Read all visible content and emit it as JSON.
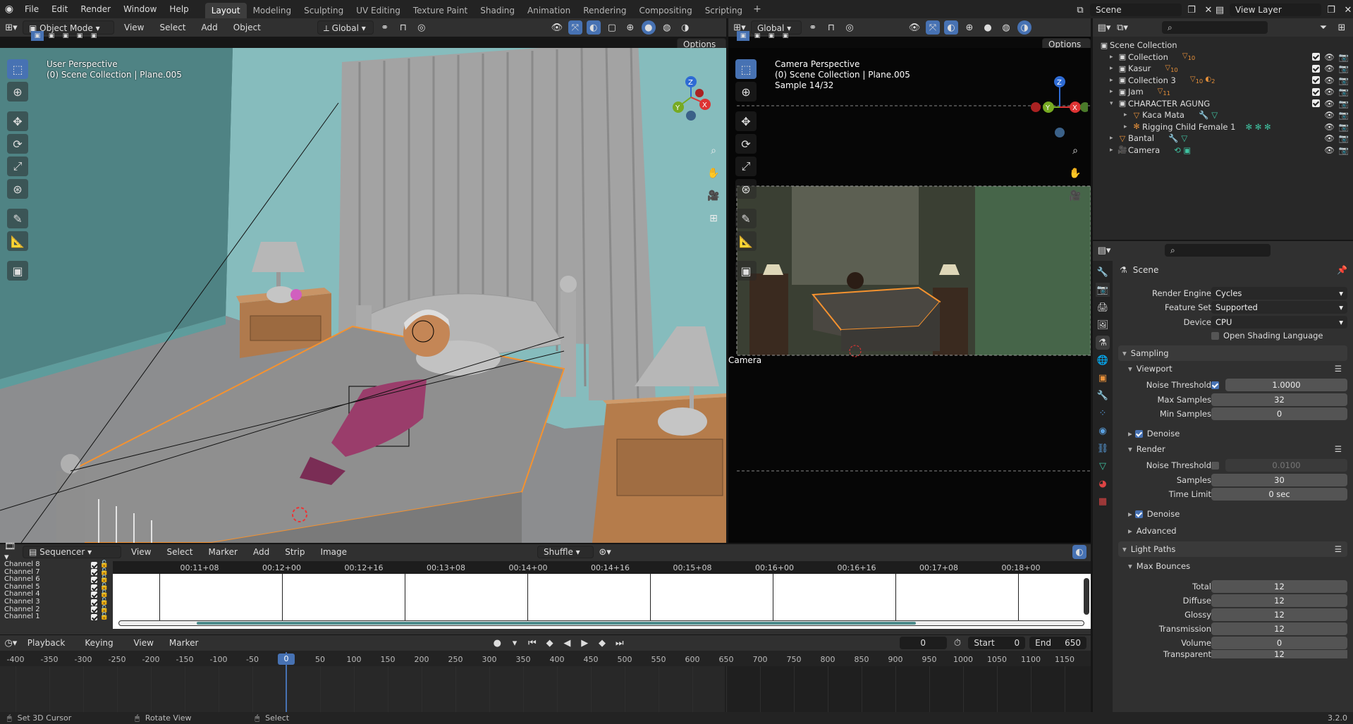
{
  "topbar": {
    "menus": [
      "File",
      "Edit",
      "Render",
      "Window",
      "Help"
    ],
    "workspaces": [
      "Layout",
      "Modeling",
      "Sculpting",
      "UV Editing",
      "Texture Paint",
      "Shading",
      "Animation",
      "Rendering",
      "Compositing",
      "Scripting"
    ],
    "active_workspace": "Layout",
    "add_tab": "+",
    "scene": "Scene",
    "view_layer": "View Layer"
  },
  "viewport_left": {
    "mode": "Object Mode",
    "menus": [
      "View",
      "Select",
      "Add",
      "Object"
    ],
    "orientation": "Global",
    "options": "Options",
    "overlay_line1": "User Perspective",
    "overlay_line2": "(0) Scene Collection | Plane.005"
  },
  "viewport_right": {
    "orientation": "Global",
    "options": "Options",
    "overlay_line1": "Camera Perspective",
    "overlay_line2": "(0) Scene Collection | Plane.005",
    "overlay_line3": "Sample 14/32",
    "camera_label": "Camera"
  },
  "gizmo": {
    "x": "X",
    "y": "Y",
    "z": "Z"
  },
  "outliner": {
    "search_placeholder": "",
    "root": "Scene Collection",
    "items": [
      {
        "label": "Collection",
        "badge": "10"
      },
      {
        "label": "Kasur",
        "badge": "10"
      },
      {
        "label": "Collection 3",
        "badge": "10",
        "badge2": "2"
      },
      {
        "label": "Jam",
        "badge": "11"
      },
      {
        "label": "CHARACTER AGUNG",
        "badge": ""
      },
      {
        "label": "Kaca Mata",
        "badge": ""
      },
      {
        "label": "Rigging Child Female 1",
        "badge": ""
      },
      {
        "label": "Bantal",
        "badge": ""
      },
      {
        "label": "Camera",
        "badge": ""
      }
    ]
  },
  "properties": {
    "context": "Scene",
    "render_engine_label": "Render Engine",
    "render_engine": "Cycles",
    "feature_set_label": "Feature Set",
    "feature_set": "Supported",
    "device_label": "Device",
    "device": "CPU",
    "osl_label": "Open Shading Language",
    "sampling": "Sampling",
    "viewport": "Viewport",
    "vp_noise_label": "Noise Threshold",
    "vp_noise": "1.0000",
    "vp_max_label": "Max Samples",
    "vp_max": "32",
    "vp_min_label": "Min Samples",
    "vp_min": "0",
    "denoise": "Denoise",
    "render": "Render",
    "r_noise_label": "Noise Threshold",
    "r_noise": "0.0100",
    "r_samples_label": "Samples",
    "r_samples": "30",
    "r_time_label": "Time Limit",
    "r_time": "0 sec",
    "advanced": "Advanced",
    "light_paths": "Light Paths",
    "max_bounces": "Max Bounces",
    "total_label": "Total",
    "total": "12",
    "diffuse_label": "Diffuse",
    "diffuse": "12",
    "glossy_label": "Glossy",
    "glossy": "12",
    "transmission_label": "Transmission",
    "transmission": "12",
    "volume_label": "Volume",
    "volume": "0",
    "transparent_label": "Transparent",
    "transparent": "12"
  },
  "sequencer": {
    "editor": "Sequencer",
    "menus": [
      "View",
      "Select",
      "Marker",
      "Add",
      "Strip",
      "Image"
    ],
    "mode": "Shuffle",
    "ticks": [
      "00:11+08",
      "00:12+00",
      "00:12+16",
      "00:13+08",
      "00:14+00",
      "00:14+16",
      "00:15+08",
      "00:16+00",
      "00:16+16",
      "00:17+08",
      "00:18+00"
    ],
    "channels": [
      "Channel 8",
      "Channel 7",
      "Channel 6",
      "Channel 5",
      "Channel 4",
      "Channel 3",
      "Channel 2",
      "Channel 1"
    ]
  },
  "timeline": {
    "menus": [
      "Playback",
      "Keying",
      "View",
      "Marker"
    ],
    "current_frame": "0",
    "start_label": "Start",
    "start": "0",
    "end_label": "End",
    "end": "650",
    "ticks": [
      "-400",
      "-350",
      "-300",
      "-250",
      "-200",
      "-150",
      "-100",
      "-50",
      "0",
      "50",
      "100",
      "150",
      "200",
      "250",
      "300",
      "350",
      "400",
      "450",
      "500",
      "550",
      "600",
      "650",
      "700",
      "750",
      "800",
      "850",
      "900",
      "950",
      "1000",
      "1050",
      "1100",
      "1150"
    ]
  },
  "statusbar": {
    "hint1": "Set 3D Cursor",
    "hint2": "Rotate View",
    "hint3": "Select",
    "version": "3.2.0"
  },
  "colors": {
    "accent": "#4772b3",
    "selection_orange": "#f5922f",
    "wall": "#7fb5b6",
    "header": "#303030"
  }
}
